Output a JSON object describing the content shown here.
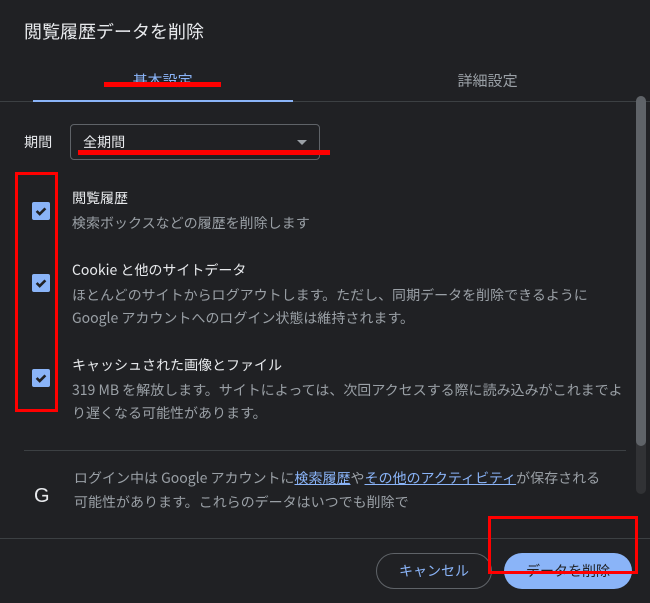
{
  "dialog": {
    "title": "閲覧履歴データを削除"
  },
  "tabs": {
    "basic": "基本設定",
    "advanced": "詳細設定"
  },
  "period": {
    "label": "期間",
    "selected": "全期間"
  },
  "options": {
    "history": {
      "title": "閲覧履歴",
      "desc": "検索ボックスなどの履歴を削除します"
    },
    "cookies": {
      "title": "Cookie と他のサイトデータ",
      "desc": "ほとんどのサイトからログアウトします。ただし、同期データを削除できるように Google アカウントへのログイン状態は維持されます。"
    },
    "cache": {
      "title": "キャッシュされた画像とファイル",
      "desc": "319 MB を解放します。サイトによっては、次回アクセスする際に読み込みがこれまでより遅くなる可能性があります。"
    }
  },
  "note": {
    "text1": "ログイン中は Google アカウントに",
    "link1": "検索履歴",
    "text2": "や",
    "link2": "その他のアクティビティ",
    "text3": "が保存される可能性があります。これらのデータはいつでも削除で"
  },
  "buttons": {
    "cancel": "キャンセル",
    "delete": "データを削除"
  }
}
